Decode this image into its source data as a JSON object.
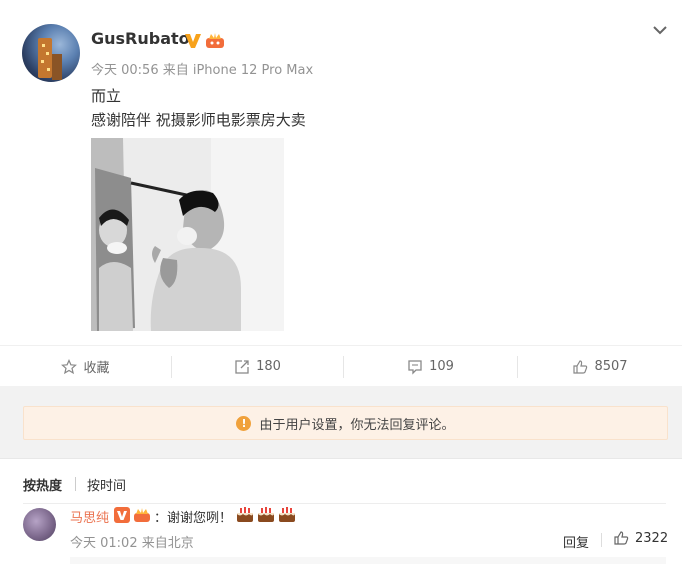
{
  "post": {
    "username": "GusRubato",
    "meta": "今天 00:56 来自 iPhone 12 Pro Max",
    "text_line1": "而立",
    "text_line2": "感谢陪伴 祝摄影师电影票房大卖"
  },
  "actions": {
    "favorite_label": "收藏",
    "repost_count": "180",
    "comment_count": "109",
    "like_count": "8507"
  },
  "notice": {
    "text": "由于用户设置，你无法回复评论。"
  },
  "sort": {
    "hot": "按热度",
    "time": "按时间"
  },
  "comment": {
    "name": "马思纯",
    "text": "：谢谢您咧！",
    "meta": "今天 01:02 来自北京",
    "reply": "回复",
    "likes": "2322",
    "emoji": [
      "cake-emoji",
      "cake-emoji",
      "cake-emoji"
    ]
  },
  "colors": {
    "accent_name": "#eb7350",
    "vbadge": "#f7a21b",
    "notice_bg": "#fdf1e6",
    "warn": "#f0a13b"
  }
}
